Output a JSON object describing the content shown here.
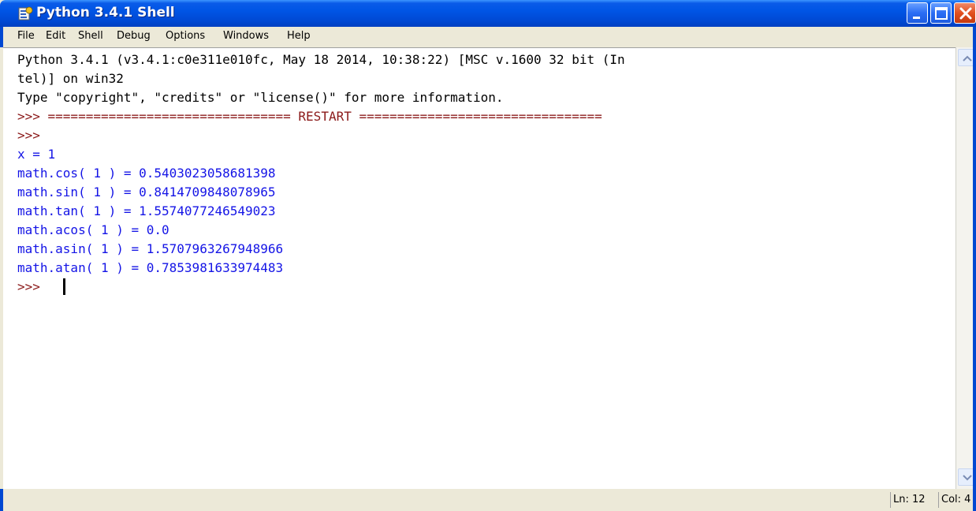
{
  "window": {
    "title": "Python 3.4.1 Shell",
    "icon": "python-idle-icon"
  },
  "menu": [
    {
      "label": "File"
    },
    {
      "label": "Edit"
    },
    {
      "label": "Shell"
    },
    {
      "label": "Debug"
    },
    {
      "label": "Options"
    },
    {
      "label": "Windows"
    },
    {
      "label": "Help"
    }
  ],
  "shell": {
    "lines": [
      {
        "text": "Python 3.4.1 (v3.4.1:c0e311e010fc, May 18 2014, 10:38:22) [MSC v.1600 32 bit (In",
        "kind": "banner"
      },
      {
        "text": "tel)] on win32",
        "kind": "banner"
      },
      {
        "text": "Type \"copyright\", \"credits\" or \"license()\" for more information.",
        "kind": "banner"
      },
      {
        "text": ">>> ================================ RESTART ================================",
        "kind": "prompt"
      },
      {
        "text": ">>>",
        "kind": "prompt"
      },
      {
        "text": "x = 1",
        "kind": "output"
      },
      {
        "text": "math.cos( 1 ) = 0.5403023058681398",
        "kind": "output"
      },
      {
        "text": "math.sin( 1 ) = 0.8414709848078965",
        "kind": "output"
      },
      {
        "text": "math.tan( 1 ) = 1.5574077246549023",
        "kind": "output"
      },
      {
        "text": "math.acos( 1 ) = 0.0",
        "kind": "output"
      },
      {
        "text": "math.asin( 1 ) = 1.5707963267948966",
        "kind": "output"
      },
      {
        "text": "math.atan( 1 ) = 0.7853981633974483",
        "kind": "output"
      },
      {
        "text": ">>>",
        "kind": "prompt"
      }
    ]
  },
  "status": {
    "line": "Ln: 12",
    "column": "Col: 4"
  },
  "colors": {
    "titlebar": "#0055e5",
    "prompt": "#8b1a1a",
    "output": "#1414e6",
    "close_button": "#e2501f"
  }
}
